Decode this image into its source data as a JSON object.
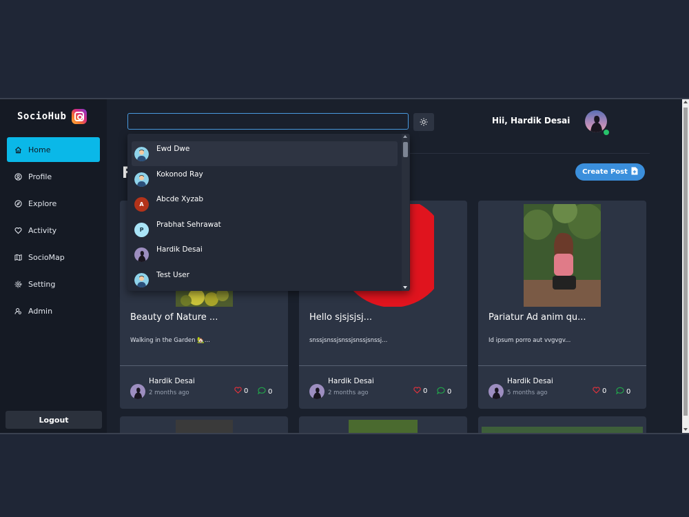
{
  "brand": {
    "name": "SocioHub",
    "logo_icon": "instagram-logo-icon"
  },
  "sidebar": {
    "items": [
      {
        "label": "Home",
        "icon": "home-icon",
        "active": true
      },
      {
        "label": "Profile",
        "icon": "user-circle-icon",
        "active": false
      },
      {
        "label": "Explore",
        "icon": "compass-icon",
        "active": false
      },
      {
        "label": "Activity",
        "icon": "heart-icon",
        "active": false
      },
      {
        "label": "SocioMap",
        "icon": "map-icon",
        "active": false
      },
      {
        "label": "Setting",
        "icon": "gear-icon",
        "active": false
      },
      {
        "label": "Admin",
        "icon": "admin-icon",
        "active": false
      }
    ],
    "logout_label": "Logout"
  },
  "header": {
    "search_value": "",
    "theme_icon": "sun-icon",
    "greeting": "Hii, Hardik Desai"
  },
  "main": {
    "title_visible": "F",
    "create_post_label": "Create Post"
  },
  "search_results": [
    {
      "name": "Ewd Dwe",
      "avatar": "default-avatar"
    },
    {
      "name": "Kokonod Ray",
      "avatar": "default-avatar"
    },
    {
      "name": "Abcde Xyzab",
      "avatar": "letter-avatar",
      "initial": "A"
    },
    {
      "name": "Prabhat Sehrawat",
      "avatar": "letter-avatar",
      "initial": "P"
    },
    {
      "name": "Hardik Desai",
      "avatar": "photo-avatar"
    },
    {
      "name": "Test User",
      "avatar": "default-avatar"
    }
  ],
  "posts": [
    {
      "title": "Beauty of Nature ...",
      "description": "Walking in the Garden 🏡...",
      "author": "Hardik Desai",
      "time": "2 months ago",
      "likes": "0",
      "comments": "0"
    },
    {
      "title": "Hello sjsjsjsj...",
      "description": "snssjsnssjsnssjsnssjsnssj...",
      "author": "Hardik Desai",
      "time": "2 months ago",
      "likes": "0",
      "comments": "0"
    },
    {
      "title": "Pariatur Ad anim qu...",
      "description": "Id ipsum porro aut vvgvgv...",
      "author": "Hardik Desai",
      "time": "5 months ago",
      "likes": "0",
      "comments": "0"
    }
  ],
  "colors": {
    "accent": "#0ab8e8",
    "button": "#3b8fdc",
    "like": "#e0323c",
    "comment": "#22a24a"
  }
}
